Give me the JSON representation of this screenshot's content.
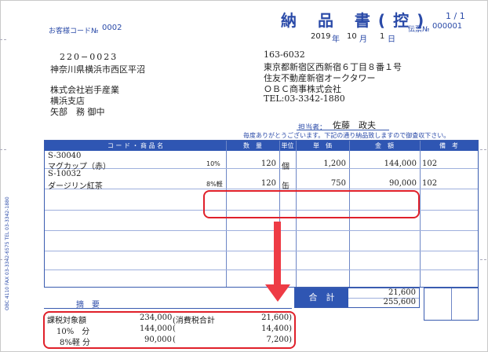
{
  "header": {
    "customer_code_label": "お客様コード№",
    "customer_code": "0002",
    "title": "納 品 書(控)",
    "page": "1 / 1",
    "date_year": "2019",
    "date_year_unit": "年",
    "date_month": "10",
    "date_month_unit": "月",
    "date_day": "1",
    "date_day_unit": "日",
    "slip_label": "伝票№",
    "slip_no": "000001"
  },
  "recipient": {
    "postal": "220−0023",
    "address": "神奈川県横浜市西区平沼",
    "company": "株式会社岩手産業",
    "branch": "横浜支店",
    "person": "矢部　務 御中"
  },
  "sender": {
    "postal": "163-6032",
    "address1": "東京都新宿区西新宿６丁目８番１号",
    "address2": "住友不動産新宿オークタワー",
    "company": "ＯＢＣ商事株式会社",
    "tel": "TEL:03-3342-1880",
    "staff_label": "担当者：",
    "staff_name": "佐藤　政夫"
  },
  "message": "毎度ありがとうございます。下記の通り納品致しますので御査収下さい。",
  "table": {
    "headers": {
      "code_name": "コ ー ド ・ 商 品 名",
      "qty": "数　量",
      "unit": "単位",
      "price": "単　価",
      "amount": "金　額",
      "note": "備　考"
    },
    "rows": [
      {
        "code": "S-30040",
        "name": "マグカップ（赤）",
        "tax": "10%",
        "qty": "120",
        "unit": "個",
        "price": "1,200",
        "amount": "144,000",
        "note": "102"
      },
      {
        "code": "S-10032",
        "name": "ダージリン紅茶",
        "tax": "8%軽",
        "qty": "120",
        "unit": "缶",
        "price": "750",
        "amount": "90,000",
        "note": "102"
      }
    ]
  },
  "summary": {
    "memo_label": "摘　要",
    "total_label": "合　計",
    "tax_total": "21,600",
    "grand_total": "255,600"
  },
  "tax_breakdown": {
    "taxable_label": "課税対象額",
    "taxable_amount": "234,000",
    "tax_sum_label": "(消費税合計",
    "tax_sum": "21,600)",
    "rate10_label": "10%　分",
    "rate10_amount": "144,000",
    "rate10_open": "(",
    "rate10_tax": "14,400)",
    "rate8_label": "8%軽 分",
    "rate8_amount": "90,000",
    "rate8_open": "(",
    "rate8_tax": "7,200)"
  },
  "side_text": "OBC 4110 FAX 03-3342-6575 TEL 03-3342-1880",
  "colors": {
    "accent_blue": "#2f56b3",
    "highlight_red": "#e0202a"
  }
}
